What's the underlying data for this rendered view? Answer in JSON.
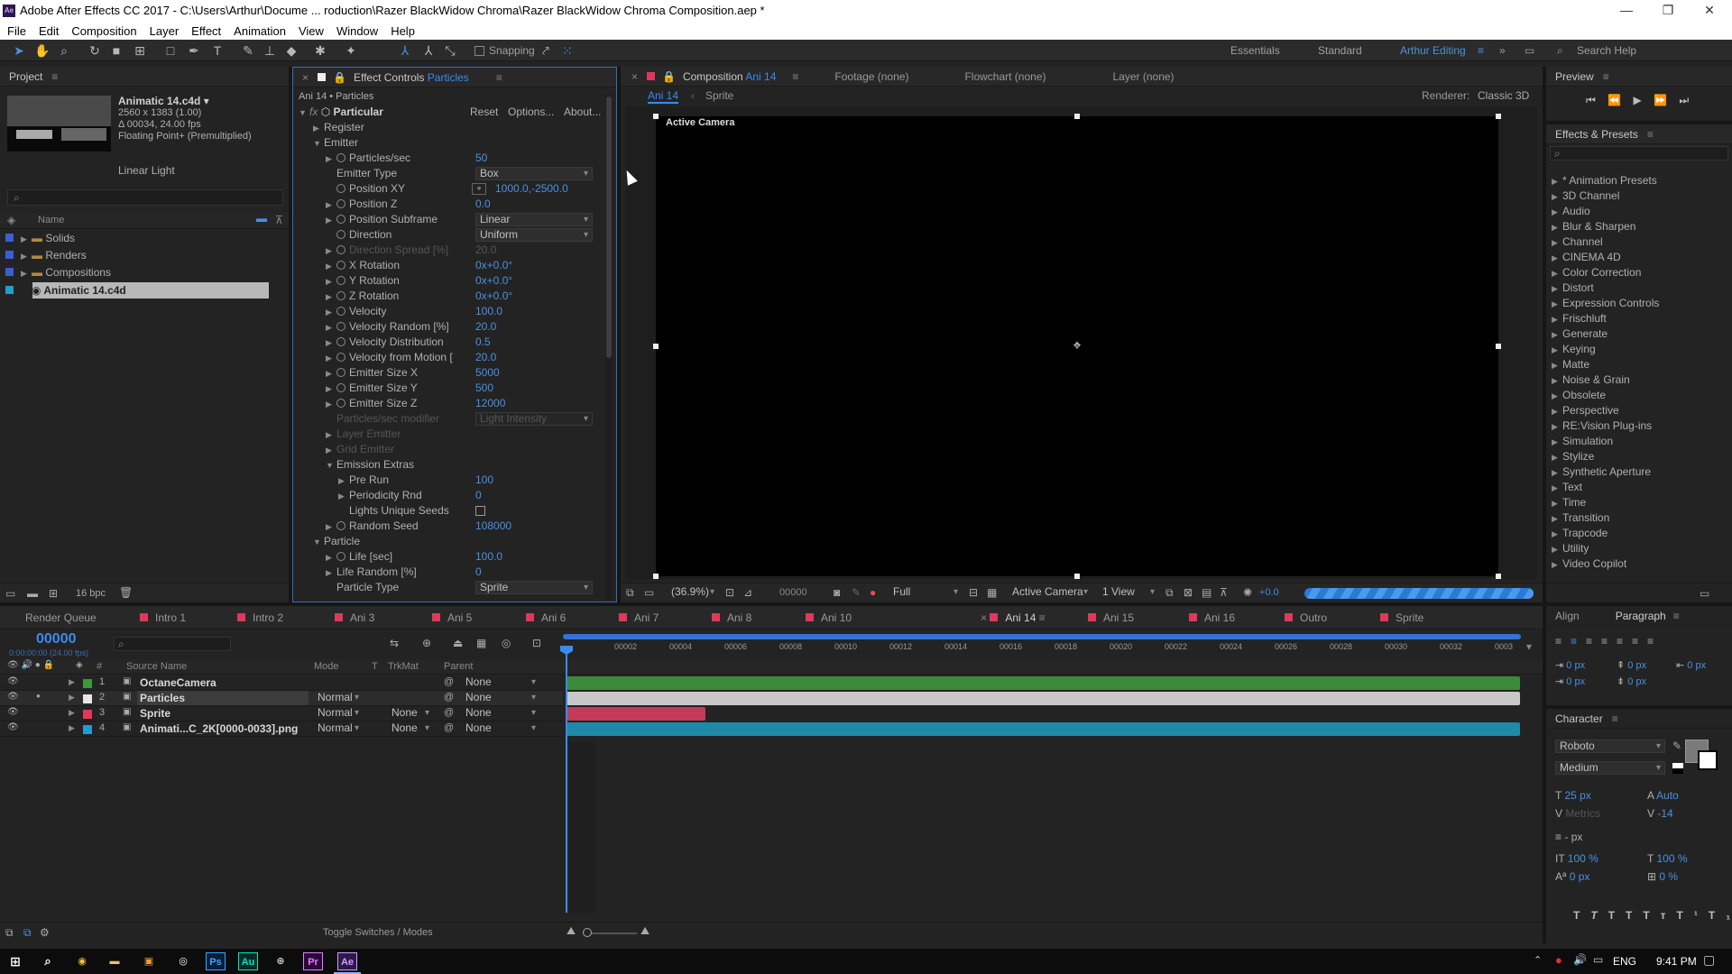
{
  "titlebar": {
    "title": "Adobe After Effects CC 2017 - C:\\Users\\Arthur\\Docume ... roduction\\Razer BlackWidow Chroma\\Razer BlackWidow Chroma Composition.aep *",
    "app_icon": "Ae"
  },
  "menu": [
    "File",
    "Edit",
    "Composition",
    "Layer",
    "Effect",
    "Animation",
    "View",
    "Window",
    "Help"
  ],
  "toolbar": {
    "snapping": "Snapping",
    "workspaces": [
      "Essentials",
      "Standard",
      "Arthur Editing"
    ],
    "search": "Search Help"
  },
  "project": {
    "title": "Project",
    "item_name": "Animatic 14.c4d ▾",
    "item_dims": "2560 x 1383 (1.00)",
    "item_duration": "Δ 00034, 24.00 fps",
    "item_depth": "Floating Point+ (Premultiplied)",
    "item_blend": "Linear Light",
    "col_name": "Name",
    "items": [
      "Solids",
      "Renders",
      "Compositions",
      "Animatic 14.c4d"
    ],
    "bpc": "16 bpc"
  },
  "effect": {
    "tab_prefix": "Effect Controls ",
    "tab_layer": "Particles",
    "breadcrumb": "Ani 14 • Particles",
    "name": "Particular",
    "reset": "Reset",
    "options": "Options...",
    "about": "About...",
    "rows": [
      {
        "label": "Register",
        "indent": 1,
        "tri": "▶",
        "sw": false,
        "value": ""
      },
      {
        "label": "Emitter",
        "indent": 1,
        "tri": "▼",
        "sw": false,
        "value": ""
      },
      {
        "label": "Particles/sec",
        "indent": 2,
        "tri": "▶",
        "sw": true,
        "value": "50"
      },
      {
        "label": "Emitter Type",
        "indent": 2,
        "tri": "",
        "sw": false,
        "value": "",
        "dd": "Box"
      },
      {
        "label": "Position XY",
        "indent": 2,
        "tri": "",
        "sw": true,
        "value": "1000.0,-2500.0",
        "pos": true
      },
      {
        "label": "Position Z",
        "indent": 2,
        "tri": "▶",
        "sw": true,
        "value": "0.0"
      },
      {
        "label": "Position Subframe",
        "indent": 2,
        "tri": "▶",
        "sw": true,
        "value": "",
        "dd": "Linear"
      },
      {
        "label": "Direction",
        "indent": 2,
        "tri": "",
        "sw": true,
        "value": "",
        "dd": "Uniform"
      },
      {
        "label": "Direction Spread [%]",
        "indent": 2,
        "tri": "▶",
        "sw": true,
        "value": "20.0",
        "dim": true
      },
      {
        "label": "X Rotation",
        "indent": 2,
        "tri": "▶",
        "sw": true,
        "value": "0x+0.0°"
      },
      {
        "label": "Y Rotation",
        "indent": 2,
        "tri": "▶",
        "sw": true,
        "value": "0x+0.0°"
      },
      {
        "label": "Z Rotation",
        "indent": 2,
        "tri": "▶",
        "sw": true,
        "value": "0x+0.0°"
      },
      {
        "label": "Velocity",
        "indent": 2,
        "tri": "▶",
        "sw": true,
        "value": "100.0"
      },
      {
        "label": "Velocity Random [%]",
        "indent": 2,
        "tri": "▶",
        "sw": true,
        "value": "20.0"
      },
      {
        "label": "Velocity Distribution",
        "indent": 2,
        "tri": "▶",
        "sw": true,
        "value": "0.5"
      },
      {
        "label": "Velocity from Motion [",
        "indent": 2,
        "tri": "▶",
        "sw": true,
        "value": "20.0"
      },
      {
        "label": "Emitter Size X",
        "indent": 2,
        "tri": "▶",
        "sw": true,
        "value": "5000"
      },
      {
        "label": "Emitter Size Y",
        "indent": 2,
        "tri": "▶",
        "sw": true,
        "value": "500"
      },
      {
        "label": "Emitter Size Z",
        "indent": 2,
        "tri": "▶",
        "sw": true,
        "value": "12000"
      },
      {
        "label": "Particles/sec modifier",
        "indent": 2,
        "tri": "",
        "sw": false,
        "value": "",
        "dd": "Light Intensity",
        "dim": true
      },
      {
        "label": "Layer Emitter",
        "indent": 2,
        "tri": "▶",
        "sw": false,
        "value": "",
        "dim": true
      },
      {
        "label": "Grid Emitter",
        "indent": 2,
        "tri": "▶",
        "sw": false,
        "value": "",
        "dim": true
      },
      {
        "label": "Emission Extras",
        "indent": 2,
        "tri": "▼",
        "sw": false,
        "value": ""
      },
      {
        "label": "Pre Run",
        "indent": 3,
        "tri": "▶",
        "sw": false,
        "value": "100"
      },
      {
        "label": "Periodicity Rnd",
        "indent": 3,
        "tri": "▶",
        "sw": false,
        "value": "0"
      },
      {
        "label": "Lights Unique Seeds",
        "indent": 3,
        "tri": "",
        "sw": false,
        "value": "",
        "cb": true
      },
      {
        "label": "Random Seed",
        "indent": 2,
        "tri": "▶",
        "sw": true,
        "value": "108000"
      },
      {
        "label": "Particle",
        "indent": 1,
        "tri": "▼",
        "sw": false,
        "value": ""
      },
      {
        "label": "Life [sec]",
        "indent": 2,
        "tri": "▶",
        "sw": true,
        "value": "100.0"
      },
      {
        "label": "Life Random [%]",
        "indent": 2,
        "tri": "▶",
        "sw": false,
        "value": "0"
      },
      {
        "label": "Particle Type",
        "indent": 2,
        "tri": "",
        "sw": false,
        "value": "",
        "dd": "Sprite"
      }
    ]
  },
  "viewer": {
    "tab_prefix": "Composition ",
    "tab_comp": "Ani 14",
    "footage": "Footage (none)",
    "flowchart": "Flowchart (none)",
    "layer": "Layer (none)",
    "crumb1": "Ani 14",
    "crumb2": "Sprite",
    "renderer_label": "Renderer:",
    "renderer": "Classic 3D",
    "active_camera": "Active Camera",
    "zoom": "(36.9%)",
    "timecode": "00000",
    "quality": "Full",
    "camera": "Active Camera",
    "views": "1 View",
    "exposure": "+0.0"
  },
  "preview": {
    "title": "Preview"
  },
  "fx_presets": {
    "title": "Effects & Presets",
    "items": [
      "* Animation Presets",
      "3D Channel",
      "Audio",
      "Blur & Sharpen",
      "Channel",
      "CINEMA 4D",
      "Color Correction",
      "Distort",
      "Expression Controls",
      "Frischluft",
      "Generate",
      "Keying",
      "Matte",
      "Noise & Grain",
      "Obsolete",
      "Perspective",
      "RE:Vision Plug-ins",
      "Simulation",
      "Stylize",
      "Synthetic Aperture",
      "Text",
      "Time",
      "Transition",
      "Trapcode",
      "Utility",
      "Video Copilot"
    ]
  },
  "timeline": {
    "render_queue": "Render Queue",
    "tabs": [
      {
        "label": "Intro 1",
        "color": "#e0385a"
      },
      {
        "label": "Intro 2",
        "color": "#e0385a"
      },
      {
        "label": "Ani 3",
        "color": "#e0385a"
      },
      {
        "label": "Ani 5",
        "color": "#e0385a"
      },
      {
        "label": "Ani 6",
        "color": "#e0385a"
      },
      {
        "label": "Ani 7",
        "color": "#e0385a"
      },
      {
        "label": "Ani 8",
        "color": "#e0385a"
      },
      {
        "label": "Ani 10",
        "color": "#e0385a"
      },
      {
        "label": "Ani 14",
        "color": "#e0385a"
      },
      {
        "label": "Ani 15",
        "color": "#e0385a"
      },
      {
        "label": "Ani 16",
        "color": "#e0385a"
      },
      {
        "label": "Outro",
        "color": "#e0385a"
      },
      {
        "label": "Sprite",
        "color": "#e0385a"
      }
    ],
    "timecode": "00000",
    "timecode_sub": "0:00:00:00 (24.00 fps)",
    "col_source": "Source Name",
    "col_mode": "Mode",
    "col_t": "T",
    "col_trkmat": "TrkMat",
    "col_parent": "Parent",
    "ruler": [
      "00002",
      "00004",
      "00006",
      "00008",
      "00010",
      "00012",
      "00014",
      "00016",
      "00018",
      "00020",
      "00022",
      "00024",
      "00026",
      "00028",
      "00030",
      "00032",
      "0003"
    ],
    "layers": [
      {
        "num": "1",
        "name": "OctaneCamera",
        "label_color": "#3a9a3a",
        "mode": "",
        "trkmat": "",
        "parent": "None",
        "bar_color": "#3b8a3b",
        "bar_end": 0.995
      },
      {
        "num": "2",
        "name": "Particles",
        "label_color": "#e8e8e8",
        "mode": "Normal",
        "trkmat": "",
        "parent": "None",
        "bar_color": "#c8c8c8",
        "bar_end": 0.995
      },
      {
        "num": "3",
        "name": "Sprite",
        "label_color": "#e0385a",
        "mode": "Normal",
        "trkmat": "None",
        "parent": "None",
        "bar_color": "#c33a5a",
        "bar_end": 0.145
      },
      {
        "num": "4",
        "name": "Animati...C_2K[0000-0033].png",
        "label_color": "#1ea0c8",
        "mode": "Normal",
        "trkmat": "None",
        "parent": "None",
        "bar_color": "#1f8aa8",
        "bar_end": 0.995
      }
    ],
    "toggle": "Toggle Switches / Modes"
  },
  "align": {
    "title": "Align",
    "paragraph": "Paragraph",
    "indent_vals": [
      "0 px",
      "0 px",
      "0 px",
      "0 px",
      "0 px"
    ]
  },
  "character": {
    "title": "Character",
    "font": "Roboto",
    "style": "Medium",
    "size": "25 px",
    "leading": "Auto",
    "kerning": "Metrics",
    "tracking": "-14",
    "stroke": "- px",
    "vscale": "100 %",
    "hscale": "100 %",
    "baseline": "0 px",
    "tsume": "0 %"
  },
  "taskbar": {
    "lang": "ENG",
    "time": "9:41 PM"
  }
}
